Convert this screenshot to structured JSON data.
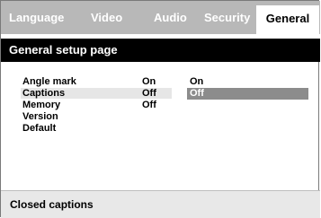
{
  "tabs": [
    {
      "label": "Language"
    },
    {
      "label": "Video"
    },
    {
      "label": "Audio"
    },
    {
      "label": "Security"
    },
    {
      "label": "General"
    }
  ],
  "page_title": "General setup page",
  "settings": [
    {
      "label": "Angle mark",
      "value": "On"
    },
    {
      "label": "Captions",
      "value": "Off"
    },
    {
      "label": "Memory",
      "value": "Off"
    },
    {
      "label": "Version",
      "value": ""
    },
    {
      "label": "Default",
      "value": ""
    }
  ],
  "options": [
    {
      "label": "On"
    },
    {
      "label": "Off"
    }
  ],
  "status_text": "Closed captions",
  "colors": {
    "tab_bar": "#b8b8b8",
    "title_bar": "#000000",
    "selected_option": "#8c8c8c",
    "row_highlight": "#e6e6e6",
    "status_bar": "#e8e8e8"
  }
}
